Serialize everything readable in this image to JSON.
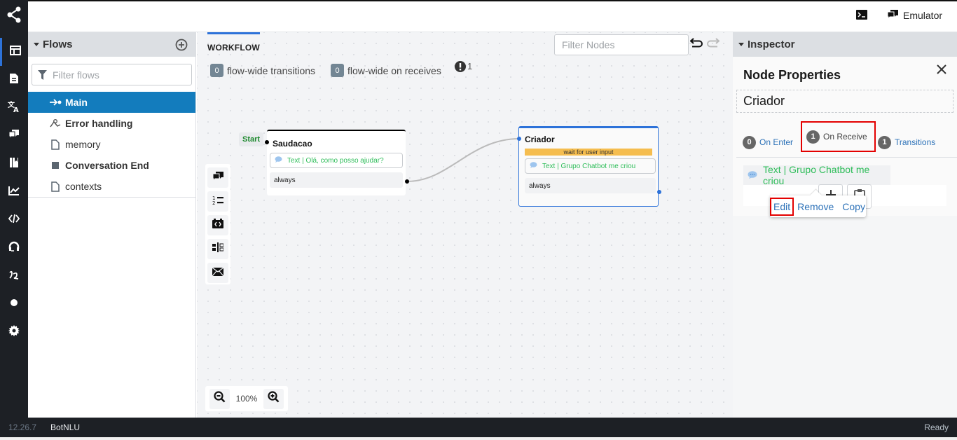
{
  "app": {
    "version": "12.26.7",
    "bot_name": "BotNLU",
    "status": "Ready"
  },
  "sidebar_nav": [
    {
      "name": "flows",
      "icon": "flows-layout-icon",
      "active": true
    },
    {
      "name": "content",
      "icon": "document-icon"
    },
    {
      "name": "translations",
      "icon": "translate-icon"
    },
    {
      "name": "qna",
      "icon": "chat-bubbles-icon"
    },
    {
      "name": "library",
      "icon": "library-icon"
    },
    {
      "name": "analytics",
      "icon": "chart-line-icon"
    },
    {
      "name": "code-editor",
      "icon": "code-icon"
    },
    {
      "name": "hitl",
      "icon": "headset-icon"
    },
    {
      "name": "nlu",
      "icon": "translation-script-icon"
    },
    {
      "name": "testing",
      "icon": "circle-icon"
    },
    {
      "name": "settings",
      "icon": "gear-icon"
    }
  ],
  "header": {
    "emulator_label": "Emulator"
  },
  "flows_panel": {
    "title": "Flows",
    "filter_placeholder": "Filter flows",
    "items": [
      {
        "label": "Main",
        "icon": "entry-icon",
        "active": true,
        "bold": true
      },
      {
        "label": "Error handling",
        "icon": "error-flow-icon",
        "bold": true
      },
      {
        "label": "memory",
        "icon": "file-icon",
        "bold": false
      },
      {
        "label": "Conversation End",
        "icon": "stop-square-icon",
        "bold": true
      },
      {
        "label": "contexts",
        "icon": "file-icon",
        "bold": false
      }
    ]
  },
  "workflow": {
    "tab_label": "WORKFLOW",
    "filter_nodes_placeholder": "Filter Nodes",
    "flow_wide_transitions_count": "0",
    "flow_wide_transitions_label": "flow-wide transitions",
    "flow_wide_receives_count": "0",
    "flow_wide_receives_label": "flow-wide on receives",
    "problems_count": "1",
    "start_label": "Start",
    "zoom_level": "100%",
    "nodes": [
      {
        "title": "Saudacao",
        "items": [
          "Text | Olá, como posso ajudar?"
        ],
        "transition": "always"
      },
      {
        "title": "Criador",
        "wait_label": "wait for user input",
        "items": [
          "Text | Grupo Chatbot me criou"
        ],
        "transition": "always"
      }
    ]
  },
  "inspector": {
    "title": "Inspector",
    "section_title": "Node Properties",
    "node_name": "Criador",
    "tabs": [
      {
        "count": "0",
        "label": "On Enter"
      },
      {
        "count": "1",
        "label": "On Receive",
        "active": true
      },
      {
        "count": "1",
        "label": "Transitions"
      }
    ],
    "action_text": "Text | Grupo Chatbot me criou",
    "popover": {
      "edit": "Edit",
      "remove": "Remove",
      "copy": "Copy"
    }
  },
  "colors": {
    "accent": "#2d72d9",
    "selected": "#137cbd",
    "success_text": "#2ebd59",
    "wait_banner": "#f5bd4f",
    "highlight": "#e30000"
  }
}
